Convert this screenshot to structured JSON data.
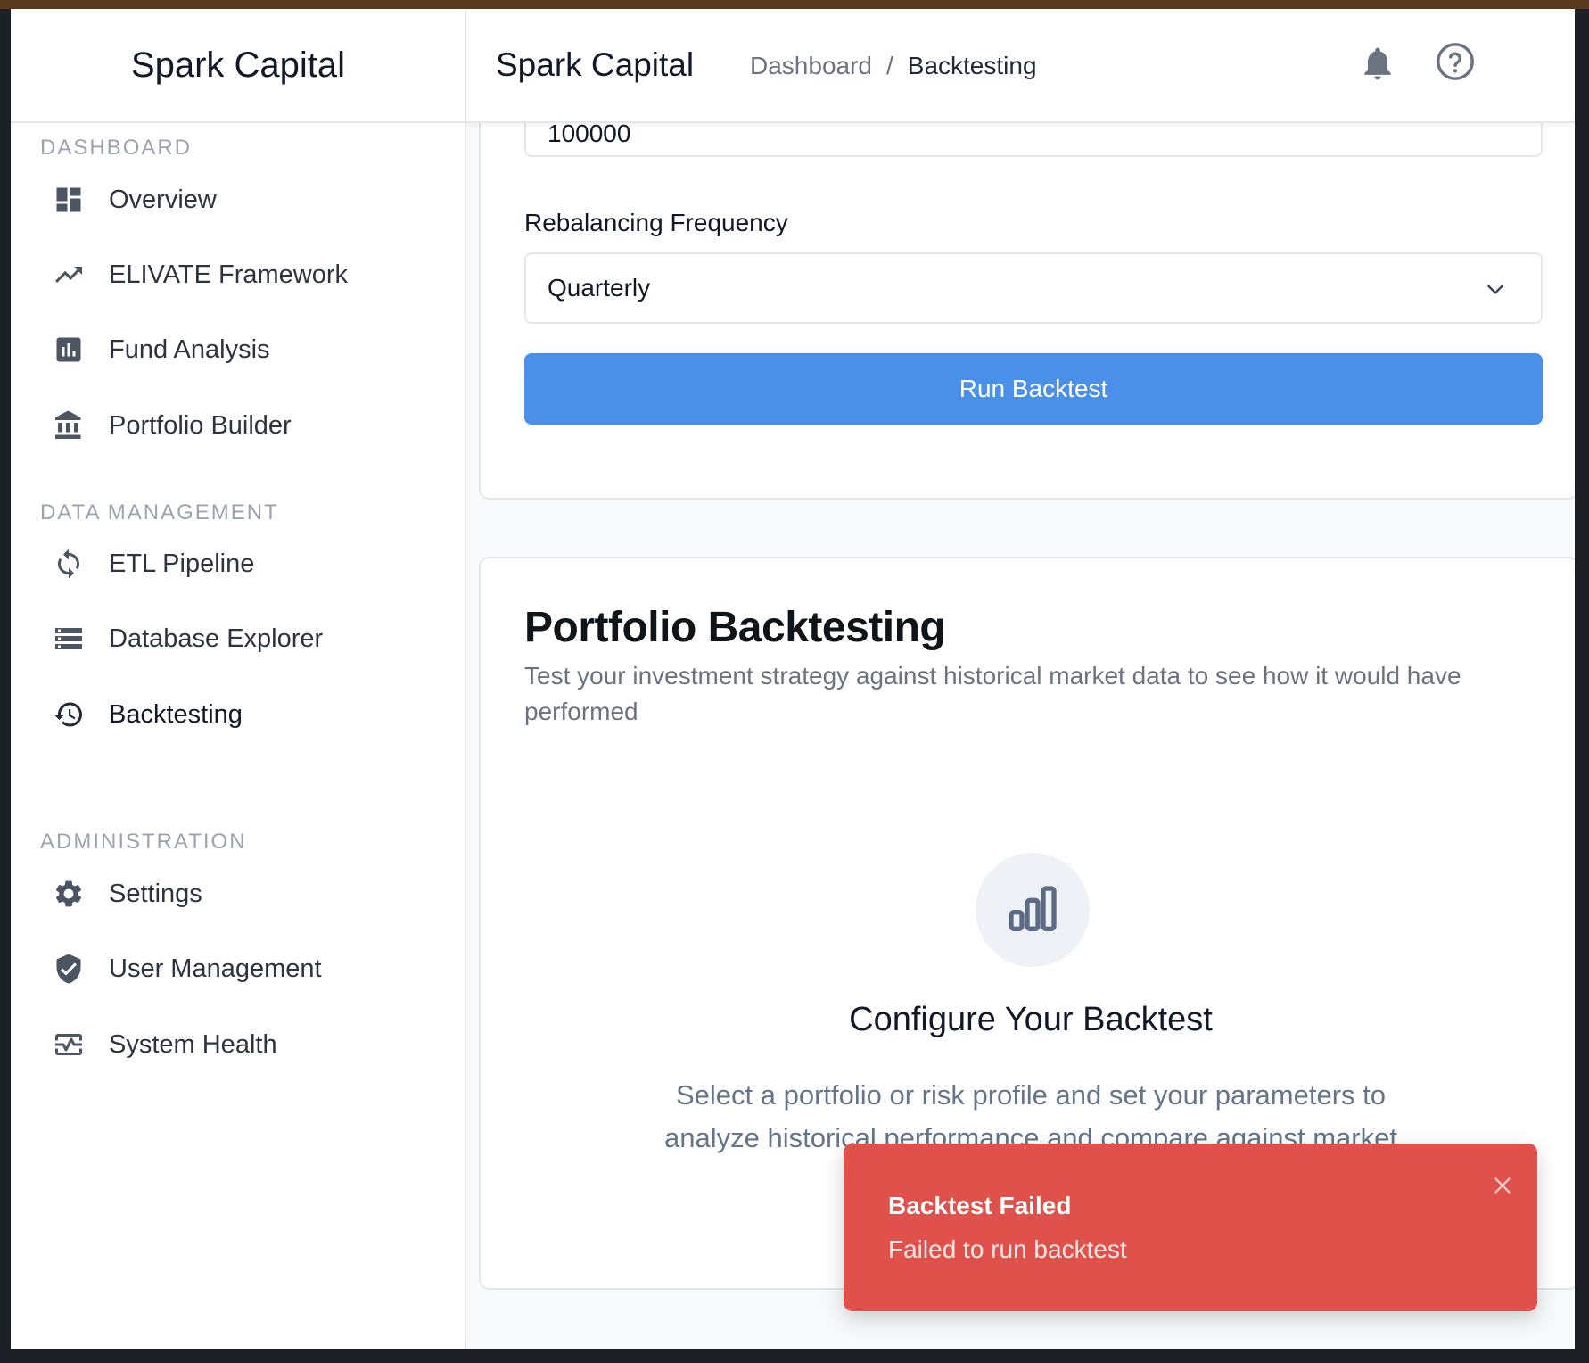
{
  "app": {
    "brand": "Spark Capital",
    "header_brand": "Spark Capital"
  },
  "breadcrumb": {
    "parent": "Dashboard",
    "separator": "/",
    "current": "Backtesting"
  },
  "sidebar": {
    "sections": [
      {
        "label": "DASHBOARD",
        "items": [
          {
            "label": "Overview",
            "icon": "dashboard-grid-icon"
          },
          {
            "label": "ELIVATE Framework",
            "icon": "trending-up-icon"
          },
          {
            "label": "Fund Analysis",
            "icon": "bar-chart-icon"
          },
          {
            "label": "Portfolio Builder",
            "icon": "bank-icon"
          }
        ]
      },
      {
        "label": "DATA MANAGEMENT",
        "items": [
          {
            "label": "ETL Pipeline",
            "icon": "sync-icon"
          },
          {
            "label": "Database Explorer",
            "icon": "storage-icon"
          },
          {
            "label": "Backtesting",
            "icon": "history-icon",
            "active": true
          }
        ]
      },
      {
        "label": "ADMINISTRATION",
        "items": [
          {
            "label": "Settings",
            "icon": "gear-icon"
          },
          {
            "label": "User Management",
            "icon": "shield-check-icon"
          },
          {
            "label": "System Health",
            "icon": "monitor-heart-icon"
          }
        ]
      }
    ]
  },
  "form": {
    "amount_value": "100000",
    "rebalancing_label": "Rebalancing Frequency",
    "rebalancing_value": "Quarterly",
    "run_button": "Run Backtest"
  },
  "results": {
    "title": "Portfolio Backtesting",
    "subtitle": "Test your investment strategy against historical market data to see how it would have performed",
    "empty_title": "Configure Your Backtest",
    "empty_text": "Select a portfolio or risk profile and set your parameters to analyze historical performance and compare against market"
  },
  "toast": {
    "title": "Backtest Failed",
    "message": "Failed to run backtest"
  },
  "colors": {
    "primary": "#4a8fe8",
    "error": "#e0514c",
    "text": "#111827",
    "muted": "#6b7280"
  }
}
